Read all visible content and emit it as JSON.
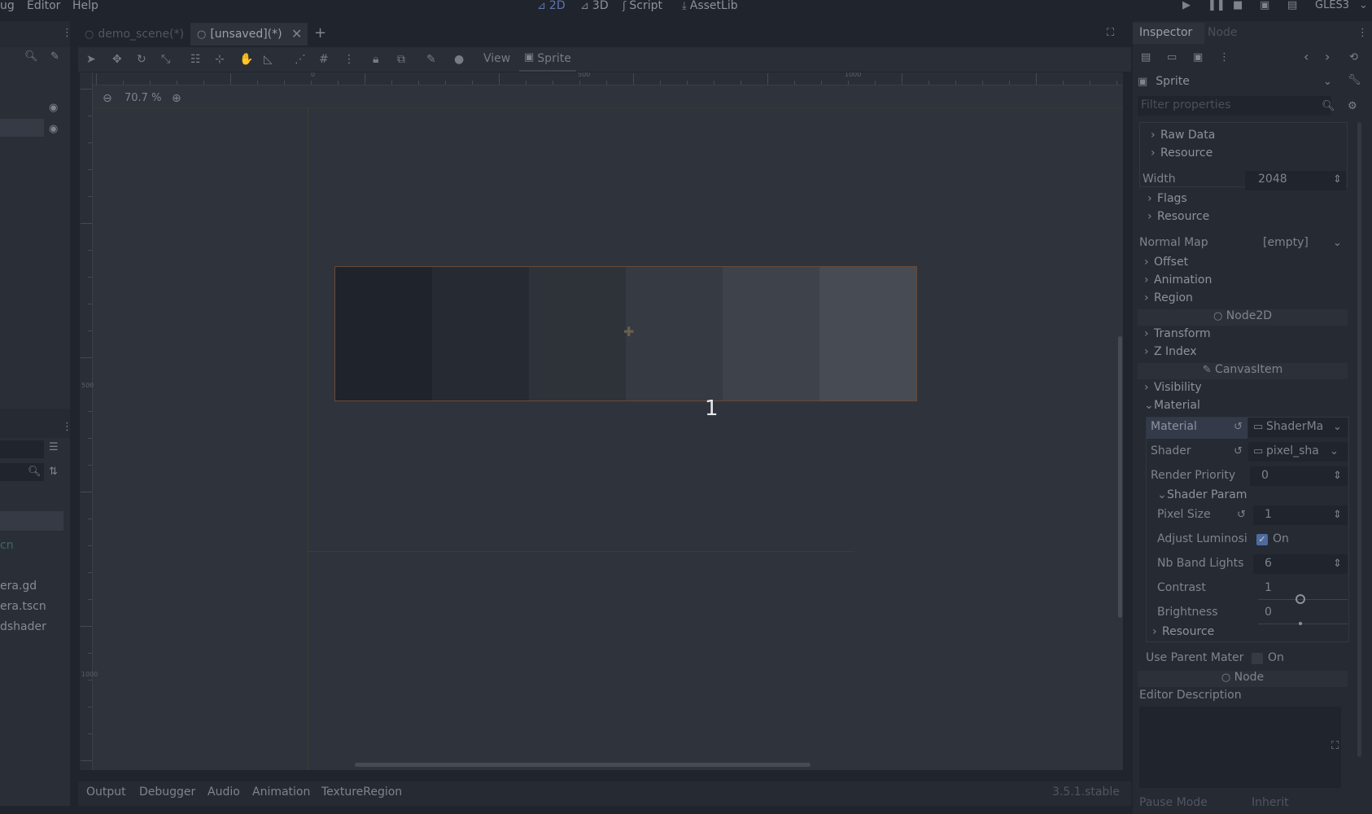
{
  "menubar": {
    "menus": [
      "ug",
      "Editor",
      "Help"
    ],
    "modes": [
      {
        "label": "2D",
        "icon": "2d-icon",
        "active": true
      },
      {
        "label": "3D",
        "icon": "3d-icon",
        "active": false
      },
      {
        "label": "Script",
        "icon": "script-icon",
        "active": false
      },
      {
        "label": "AssetLib",
        "icon": "assetlib-icon",
        "active": false
      }
    ],
    "renderer": "GLES3"
  },
  "scene_tabs": [
    {
      "label": "demo_scene(*)"
    },
    {
      "label": "[unsaved](*)"
    }
  ],
  "toolbar": {
    "view_label": "View",
    "sprite_label": "Sprite"
  },
  "viewport": {
    "zoom": "70.7 %",
    "ruler_labels": [
      "0",
      "500",
      "1000"
    ],
    "vruler_labels": [
      "500",
      "1000"
    ],
    "overlay_number": "1",
    "bands": [
      "#1f232c",
      "#262a33",
      "#2e3239",
      "#363a43",
      "#3e424b",
      "#474b54"
    ]
  },
  "filesystem": {
    "items": [
      "cn",
      "era.gd",
      "era.tscn",
      "dshader"
    ]
  },
  "bottom_tabs": [
    "Output",
    "Debugger",
    "Audio",
    "Animation",
    "TextureRegion"
  ],
  "version": "3.5.1.stable",
  "inspector": {
    "tabs": [
      "Inspector",
      "Node"
    ],
    "object_name": "Sprite",
    "filter_placeholder": "Filter properties",
    "rows": {
      "raw_data": "Raw Data",
      "resource1": "Resource",
      "width_label": "Width",
      "width_value": "2048",
      "flags": "Flags",
      "resource2": "Resource",
      "normal_map_label": "Normal Map",
      "normal_map_value": "[empty]",
      "offset": "Offset",
      "animation": "Animation",
      "region": "Region",
      "node2d": "Node2D",
      "transform": "Transform",
      "z_index": "Z Index",
      "canvasitem": "CanvasItem",
      "visibility": "Visibility",
      "material_group": "Material",
      "material_label": "Material",
      "material_value": "ShaderMa",
      "shader_label": "Shader",
      "shader_value": "pixel_sha",
      "render_priority_label": "Render Priority",
      "render_priority_value": "0",
      "shader_param": "Shader Param",
      "pixel_size_label": "Pixel Size",
      "pixel_size_value": "1",
      "adjust_lum_label": "Adjust Luminosi",
      "adjust_lum_value": "On",
      "nb_band_label": "Nb Band Lights",
      "nb_band_value": "6",
      "contrast_label": "Contrast",
      "contrast_value": "1",
      "brightness_label": "Brightness",
      "brightness_value": "0",
      "resource3": "Resource",
      "use_parent_label": "Use Parent Mater",
      "use_parent_value": "On",
      "node": "Node",
      "editor_desc": "Editor Description",
      "pause_mode_label": "Pause Mode",
      "pause_mode_value": "Inherit"
    }
  }
}
